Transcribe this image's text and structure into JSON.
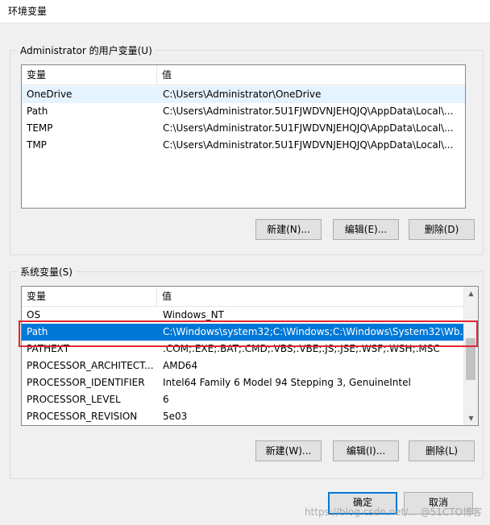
{
  "window": {
    "title": "环境变量"
  },
  "user_vars": {
    "group_label": "Administrator 的用户变量(U)",
    "columns": [
      "变量",
      "值"
    ],
    "rows": [
      {
        "name": "OneDrive",
        "value": "C:\\Users\\Administrator\\OneDrive"
      },
      {
        "name": "Path",
        "value": "C:\\Users\\Administrator.5U1FJWDVNJEHQJQ\\AppData\\Local\\..."
      },
      {
        "name": "TEMP",
        "value": "C:\\Users\\Administrator.5U1FJWDVNJEHQJQ\\AppData\\Local\\..."
      },
      {
        "name": "TMP",
        "value": "C:\\Users\\Administrator.5U1FJWDVNJEHQJQ\\AppData\\Local\\..."
      }
    ],
    "buttons": {
      "new": "新建(N)...",
      "edit": "编辑(E)...",
      "delete": "删除(D)"
    }
  },
  "system_vars": {
    "group_label": "系统变量(S)",
    "columns": [
      "变量",
      "值"
    ],
    "rows": [
      {
        "name": "OS",
        "value": "Windows_NT"
      },
      {
        "name": "Path",
        "value": "C:\\Windows\\system32;C:\\Windows;C:\\Windows\\System32\\Wb..."
      },
      {
        "name": "PATHEXT",
        "value": ".COM;.EXE;.BAT;.CMD;.VBS;.VBE;.JS;.JSE;.WSF;.WSH;.MSC"
      },
      {
        "name": "PROCESSOR_ARCHITECT...",
        "value": "AMD64"
      },
      {
        "name": "PROCESSOR_IDENTIFIER",
        "value": "Intel64 Family 6 Model 94 Stepping 3, GenuineIntel"
      },
      {
        "name": "PROCESSOR_LEVEL",
        "value": "6"
      },
      {
        "name": "PROCESSOR_REVISION",
        "value": "5e03"
      }
    ],
    "selected_row": "Path",
    "buttons": {
      "new": "新建(W)...",
      "edit": "编辑(I)...",
      "delete": "删除(L)"
    }
  },
  "footer": {
    "ok": "确定",
    "cancel": "取消"
  },
  "watermark": "https://blog.csdn.net/... @51CTO博客",
  "colors": {
    "selection": "#0078d7",
    "annotation": "#e0282e",
    "accent": "#0078d7"
  }
}
